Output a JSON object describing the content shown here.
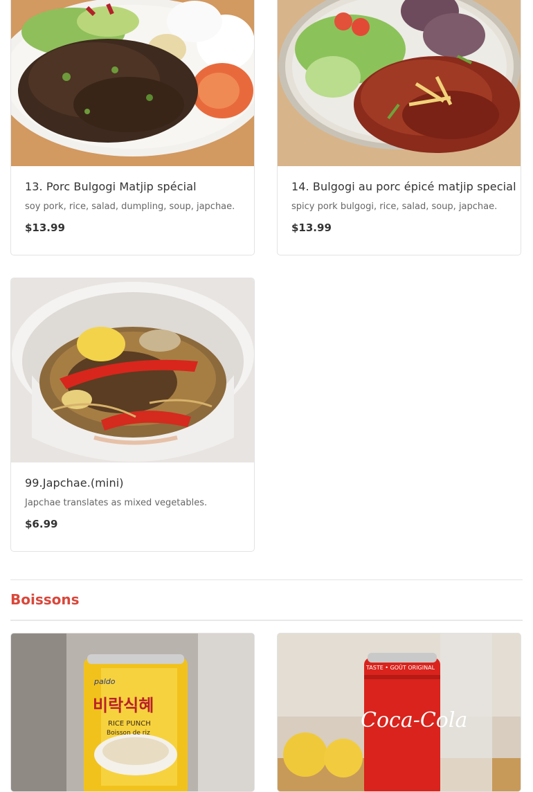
{
  "items": [
    {
      "name": "13. Porc Bulgogi Matjip spécial",
      "description": "soy pork, rice, salad, dumpling, soup, japchae.",
      "price": "$13.99"
    },
    {
      "name": "14. Bulgogi au porc épicé matjip special",
      "description": "spicy pork bulgogi, rice, salad, soup, japchae.",
      "price": "$13.99"
    },
    {
      "name": "99.Japchae.(mini)",
      "description": "Japchae translates as mixed vegetables.",
      "price": "$6.99"
    }
  ],
  "section": {
    "title": "Boissons"
  },
  "drinks": [
    {
      "label": "비락식혜",
      "sub": "RICE PUNCH",
      "sub2": "Boisson de riz",
      "brand": "paldo"
    },
    {
      "label": "Coca-Cola",
      "sub": "TASTE • GOÛT ORIGINAL"
    }
  ],
  "colors": {
    "accent": "#d9473a",
    "border": "#e3e3e3"
  }
}
